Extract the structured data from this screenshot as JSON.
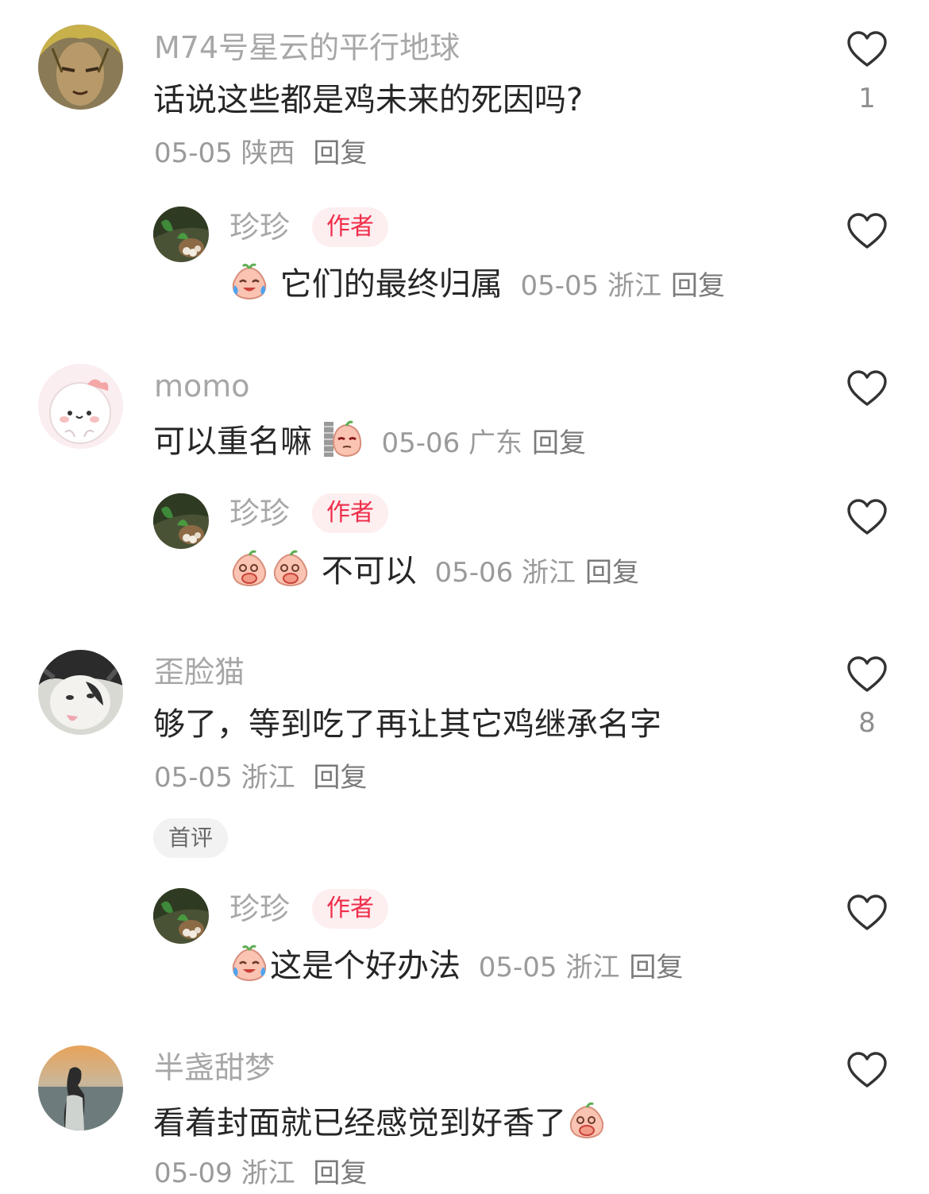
{
  "comments": [
    {
      "user": "M74号星云的平行地球",
      "text": "话说这些都是鸡未来的死因吗?",
      "date": "05-05",
      "location": "陕西",
      "reply": "回复",
      "likes": "1",
      "replies": [
        {
          "user": "珍珍",
          "badge": "作者",
          "emoji": "crying-laughing-peach",
          "text": "它们的最终归属",
          "date": "05-05",
          "location": "浙江",
          "reply": "回复"
        }
      ]
    },
    {
      "user": "momo",
      "text": "可以重名嘛",
      "emoji": "peeking-peach",
      "date": "05-06",
      "location": "广东",
      "reply": "回复",
      "replies": [
        {
          "user": "珍珍",
          "badge": "作者",
          "emoji": "giggling-peach",
          "text": "不可以",
          "date": "05-06",
          "location": "浙江",
          "reply": "回复"
        }
      ]
    },
    {
      "user": "歪脸猫",
      "text": "够了，等到吃了再让其它鸡继承名字",
      "date": "05-05",
      "location": "浙江",
      "reply": "回复",
      "likes": "8",
      "tag": "首评",
      "replies": [
        {
          "user": "珍珍",
          "badge": "作者",
          "emoji": "crying-laughing-peach",
          "text": "这是个好办法",
          "date": "05-05",
          "location": "浙江",
          "reply": "回复"
        }
      ]
    },
    {
      "user": "半盏甜梦",
      "text": "看着封面就已经感觉到好香了",
      "emoji": "giggling-peach",
      "date": "05-09",
      "location": "浙江",
      "reply": "回复"
    }
  ]
}
